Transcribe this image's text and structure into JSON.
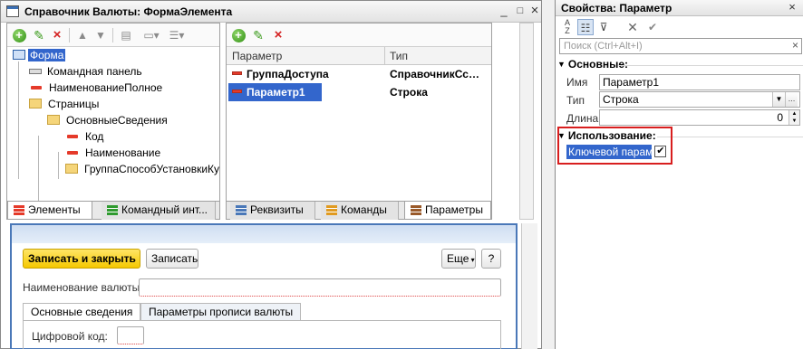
{
  "left_window": {
    "title": "Справочник Валюты: ФормаЭлемента",
    "controls": [
      "_",
      "□",
      "×"
    ],
    "tree": [
      {
        "label": "Форма"
      },
      {
        "label": "Командная панель"
      },
      {
        "label": "НаименованиеПолное"
      },
      {
        "label": "Страницы"
      },
      {
        "label": "ОсновныеСведения"
      },
      {
        "label": "Код"
      },
      {
        "label": "Наименование"
      },
      {
        "label": "ГруппаСпособУстановкиКу"
      }
    ],
    "left_tabs": [
      "Элементы",
      "Командный инт..."
    ],
    "params_header": {
      "col1": "Параметр",
      "col2": "Тип"
    },
    "params": [
      {
        "name": "ГруппаДоступа",
        "type": "СправочникСсылка.Групп..."
      },
      {
        "name": "Параметр1",
        "type": "Строка"
      }
    ],
    "right_tabs": [
      "Реквизиты",
      "Команды",
      "Параметры"
    ]
  },
  "preview": {
    "save_close": "Записать и закрыть",
    "save": "Записать",
    "more": "Еще",
    "help": "?",
    "name_label": "Наименование валюты:",
    "tabs": [
      "Основные сведения",
      "Параметры прописи валюты"
    ],
    "code_label": "Цифровой код:"
  },
  "props_window": {
    "title": "Свойства: Параметр",
    "search_placeholder": "Поиск (Ctrl+Alt+I)",
    "section_main": "Основные:",
    "name_label": "Имя",
    "name_value": "Параметр1",
    "type_label": "Тип",
    "type_value": "Строка",
    "length_label": "Длина",
    "length_value": "0",
    "section_usage": "Использование:",
    "key_param_label": "Ключевой параме",
    "key_param_checked": true
  }
}
